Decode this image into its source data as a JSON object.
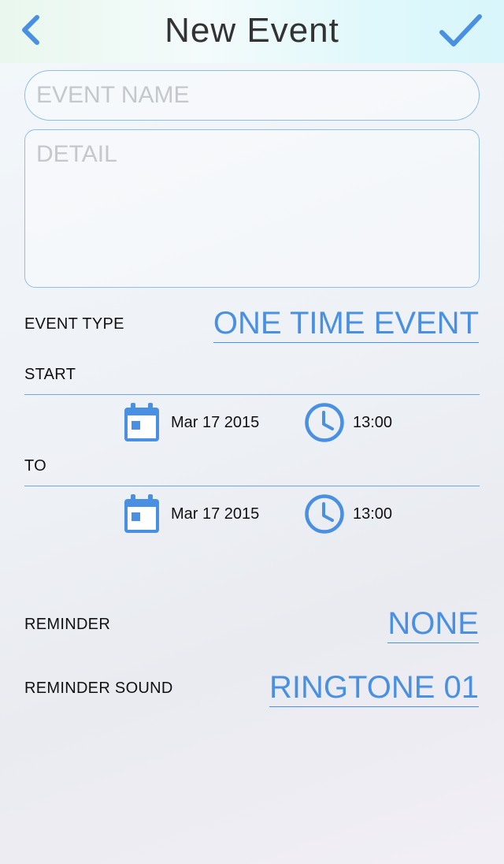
{
  "header": {
    "title": "New Event",
    "back_icon": "chevron-left-icon",
    "done_icon": "checkmark-icon"
  },
  "form": {
    "event_name_placeholder": "EVENT NAME",
    "detail_placeholder": "DETAIL",
    "event_type_label": "EVENT TYPE",
    "event_type_value": "ONE TIME EVENT",
    "start_label": "START",
    "start_date": "Mar 17 2015",
    "start_time": "13:00",
    "to_label": "TO",
    "to_date": "Mar 17 2015",
    "to_time": "13:00",
    "reminder_label": "REMINDER",
    "reminder_value": "NONE",
    "reminder_sound_label": "REMINDER SOUND",
    "reminder_sound_value": "RINGTONE 01"
  },
  "colors": {
    "accent": "#4a90e2",
    "border": "#8ebde6",
    "placeholder": "#c4c7cc"
  }
}
